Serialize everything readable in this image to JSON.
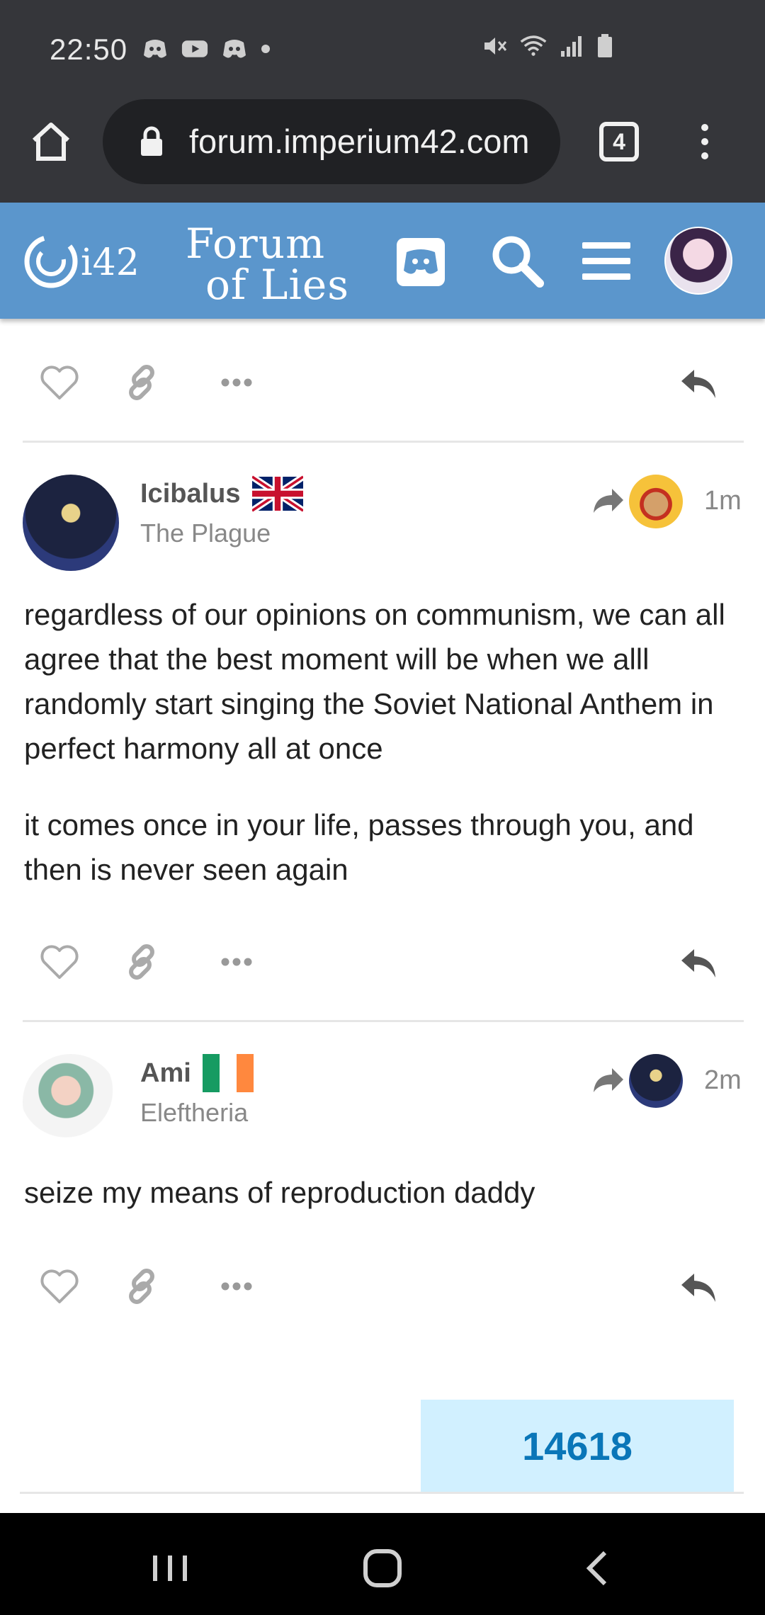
{
  "status_bar": {
    "time": "22:50",
    "icons_left": [
      "discord-notification-icon",
      "youtube-icon",
      "discord-notification-icon",
      "dot-icon"
    ],
    "icons_right": [
      "mute-icon",
      "wifi-icon",
      "signal-icon",
      "battery-icon"
    ]
  },
  "browser": {
    "url": "forum.imperium42.com",
    "tab_count": "4"
  },
  "forum_header": {
    "site_logo_text": "i42",
    "forum_logo_line1": "Forum",
    "forum_logo_line2": "of Lies",
    "brand_color": "#5b96cc"
  },
  "posts": [
    {
      "username": "Icibalus",
      "flag": "UK",
      "user_title": "The Plague",
      "time": "1m",
      "paragraphs": [
        "regardless of our opinions on communism, we can all agree that the best moment will be when we alll randomly start singing the Soviet National Anthem in perfect harmony all at once",
        "it comes once in your life, passes through you, and then is never seen again"
      ]
    },
    {
      "username": "Ami",
      "flag": "Ireland",
      "user_title": "Eleftheria",
      "time": "2m",
      "paragraphs": [
        "seize my means of reproduction daddy"
      ]
    }
  ],
  "counter": {
    "value": "14618",
    "bg_color": "#d1f0ff",
    "text_color": "#0a76b8"
  },
  "nav_bar": {
    "buttons": [
      "recent-apps",
      "home",
      "back"
    ]
  }
}
